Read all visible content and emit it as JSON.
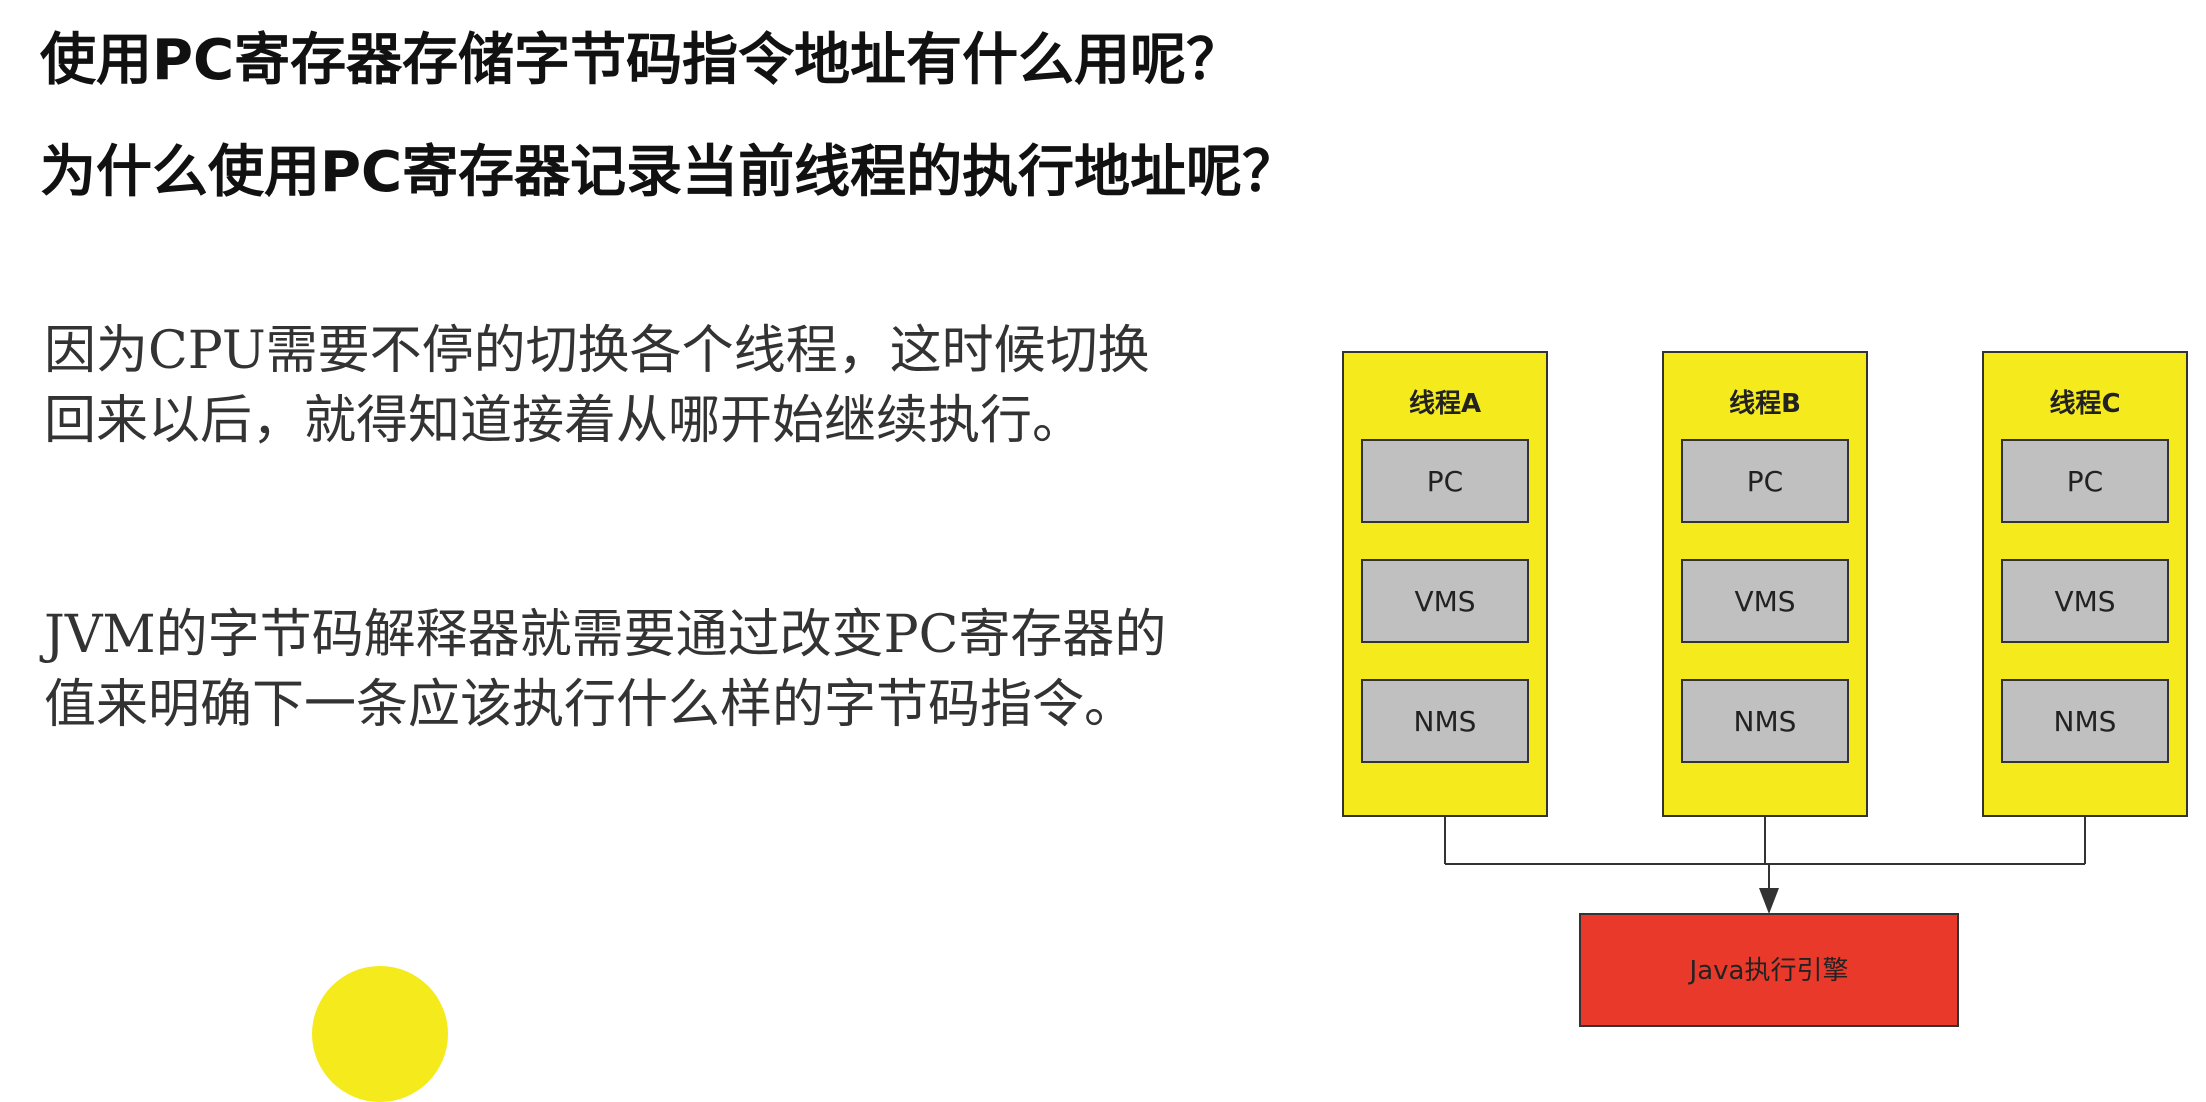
{
  "headings": {
    "line1": "使用PC寄存器存储字节码指令地址有什么用呢？",
    "line2": "为什么使用PC寄存器记录当前线程的执行地址呢？"
  },
  "body": {
    "paragraph1": "因为CPU需要不停的切换各个线程，这时候切换回来以后，就得知道接着从哪开始继续执行。",
    "paragraph2": "JVM的字节码解释器就需要通过改变PC寄存器的值来明确下一条应该执行什么样的字节码指令。"
  },
  "diagram": {
    "threads": [
      {
        "label": "线程A",
        "registers": [
          "PC",
          "VMS",
          "NMS"
        ]
      },
      {
        "label": "线程B",
        "registers": [
          "PC",
          "VMS",
          "NMS"
        ]
      },
      {
        "label": "线程C",
        "registers": [
          "PC",
          "VMS",
          "NMS"
        ]
      }
    ],
    "engine": "Java执行引擎"
  },
  "colors": {
    "thread_fill": "#f5ea1c",
    "register_fill": "#c0c0c0",
    "engine_fill": "#e8392a",
    "outline": "#333333",
    "dot": "#f5ea1c"
  }
}
